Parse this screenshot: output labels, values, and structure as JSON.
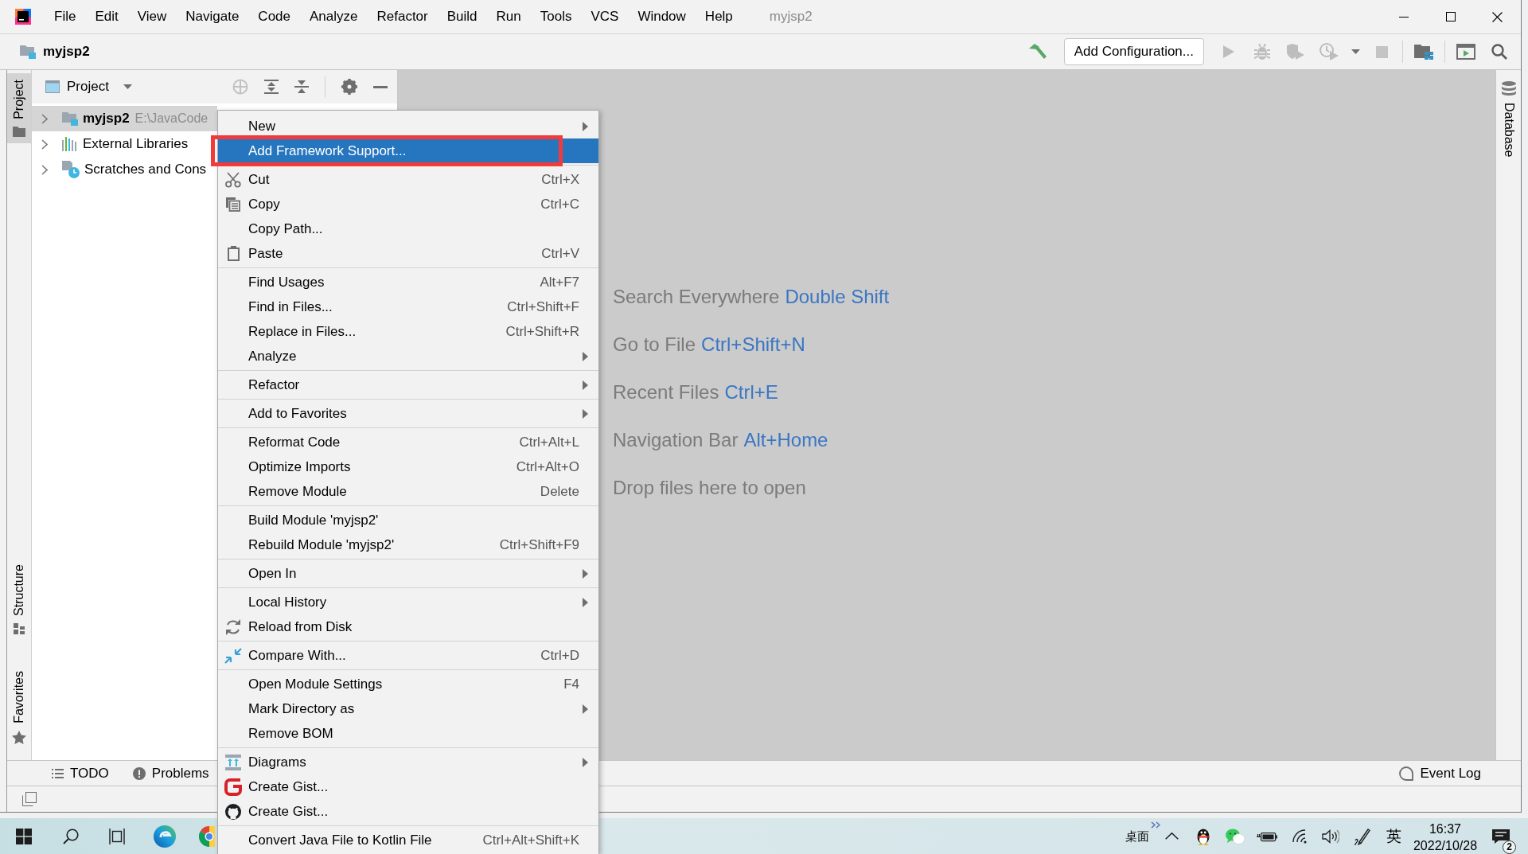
{
  "window": {
    "title": "myjsp2"
  },
  "menu_bar": [
    "File",
    "Edit",
    "View",
    "Navigate",
    "Code",
    "Analyze",
    "Refactor",
    "Build",
    "Run",
    "Tools",
    "VCS",
    "Window",
    "Help"
  ],
  "toolbar": {
    "project": "myjsp2",
    "run_configuration": "Add Configuration..."
  },
  "tool_windows": {
    "left_top": [
      {
        "label": "Project",
        "selected": true
      }
    ],
    "left_bottom": [
      {
        "label": "Structure",
        "selected": false
      },
      {
        "label": "Favorites",
        "selected": false
      }
    ],
    "right": [
      {
        "label": "Database",
        "selected": false
      }
    ]
  },
  "project_panel": {
    "title": "Project",
    "tree": [
      {
        "kind": "module",
        "label": "myjsp2",
        "path": "E:\\JavaCode",
        "selected": true,
        "expanded": false
      },
      {
        "kind": "libraries",
        "label": "External Libraries",
        "selected": false,
        "expanded": false
      },
      {
        "kind": "scratches",
        "label": "Scratches and Cons",
        "selected": false,
        "expanded": false
      }
    ]
  },
  "editor_hints": [
    {
      "label": "Search Everywhere",
      "shortcut": "Double Shift"
    },
    {
      "label": "Go to File",
      "shortcut": "Ctrl+Shift+N"
    },
    {
      "label": "Recent Files",
      "shortcut": "Ctrl+E"
    },
    {
      "label": "Navigation Bar",
      "shortcut": "Alt+Home"
    },
    {
      "label": "Drop files here to open"
    }
  ],
  "bottom_tool_windows": [
    {
      "label": "TODO"
    },
    {
      "label": "Problems"
    }
  ],
  "event_log": "Event Log",
  "context_menu": {
    "groups": [
      [
        {
          "label": "New",
          "submenu": true,
          "selected": false
        },
        {
          "label": "Add Framework Support...",
          "submenu": false,
          "selected": true
        }
      ],
      [
        {
          "label": "Cut",
          "shortcut": "Ctrl+X",
          "submenu": false,
          "selected": false
        },
        {
          "label": "Copy",
          "shortcut": "Ctrl+C",
          "submenu": false,
          "selected": false
        },
        {
          "label": "Copy Path...",
          "submenu": false,
          "selected": false
        },
        {
          "label": "Paste",
          "shortcut": "Ctrl+V",
          "submenu": false,
          "selected": false
        }
      ],
      [
        {
          "label": "Find Usages",
          "shortcut": "Alt+F7",
          "submenu": false,
          "selected": false
        },
        {
          "label": "Find in Files...",
          "shortcut": "Ctrl+Shift+F",
          "submenu": false,
          "selected": false
        },
        {
          "label": "Replace in Files...",
          "shortcut": "Ctrl+Shift+R",
          "submenu": false,
          "selected": false
        },
        {
          "label": "Analyze",
          "submenu": true,
          "selected": false
        }
      ],
      [
        {
          "label": "Refactor",
          "submenu": true,
          "selected": false
        }
      ],
      [
        {
          "label": "Add to Favorites",
          "submenu": true,
          "selected": false
        }
      ],
      [
        {
          "label": "Reformat Code",
          "shortcut": "Ctrl+Alt+L",
          "submenu": false,
          "selected": false
        },
        {
          "label": "Optimize Imports",
          "shortcut": "Ctrl+Alt+O",
          "submenu": false,
          "selected": false
        },
        {
          "label": "Remove Module",
          "shortcut": "Delete",
          "submenu": false,
          "selected": false
        }
      ],
      [
        {
          "label": "Build Module 'myjsp2'",
          "submenu": false,
          "selected": false
        },
        {
          "label": "Rebuild Module 'myjsp2'",
          "shortcut": "Ctrl+Shift+F9",
          "submenu": false,
          "selected": false
        }
      ],
      [
        {
          "label": "Open In",
          "submenu": true,
          "selected": false
        }
      ],
      [
        {
          "label": "Local History",
          "submenu": true,
          "selected": false
        },
        {
          "label": "Reload from Disk",
          "submenu": false,
          "selected": false
        }
      ],
      [
        {
          "label": "Compare With...",
          "shortcut": "Ctrl+D",
          "submenu": false,
          "selected": false
        }
      ],
      [
        {
          "label": "Open Module Settings",
          "shortcut": "F4",
          "submenu": false,
          "selected": false
        },
        {
          "label": "Mark Directory as",
          "submenu": true,
          "selected": false
        },
        {
          "label": "Remove BOM",
          "submenu": false,
          "selected": false
        }
      ],
      [
        {
          "label": "Diagrams",
          "submenu": true,
          "selected": false
        },
        {
          "label": "Create Gist...",
          "submenu": false,
          "selected": false
        },
        {
          "label": "Create Gist...",
          "submenu": false,
          "selected": false
        }
      ],
      [
        {
          "label": "Convert Java File to Kotlin File",
          "shortcut": "Ctrl+Alt+Shift+K",
          "submenu": false,
          "selected": false
        }
      ]
    ]
  },
  "taskbar": {
    "desktop": "桌面",
    "input_language": "英",
    "time": "16:37",
    "date": "2022/10/28",
    "notifications": "2"
  }
}
